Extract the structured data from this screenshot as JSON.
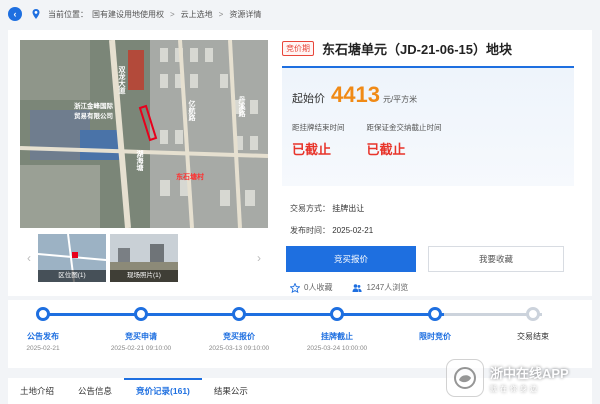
{
  "breadcrumb": {
    "prefix": "当前位置：",
    "items": [
      "国有建设用地使用权",
      "云上选地",
      "资源详情"
    ],
    "separator": ">"
  },
  "listing": {
    "badge": "竞价期",
    "title": "东石塘单元（JD-21-06-15）地块"
  },
  "price": {
    "label": "起始价",
    "value": "4413",
    "unit": "元/平方米"
  },
  "deadlines": [
    {
      "label": "距挂牌结束时间",
      "value": "已截止"
    },
    {
      "label": "距保证金交纳截止时间",
      "value": "已截止"
    }
  ],
  "meta": {
    "method_label": "交易方式：",
    "method_value": "挂牌出让",
    "published_label": "发布时间：",
    "published_value": "2025-02-21"
  },
  "actions": {
    "bid": "竞买报价",
    "favorite": "我要收藏"
  },
  "stats": {
    "favorites": "0人收藏",
    "views": "1247人浏览"
  },
  "map": {
    "road_1": "双龙大道",
    "road_2": "亿航路",
    "road_3": "丹溪路",
    "road_4": "湖海塘",
    "company": "浙江金峰国际\n贸易有限公司",
    "site": "东石塘村"
  },
  "thumbs": [
    "区位图(1)",
    "现场照片(1)"
  ],
  "timeline": [
    {
      "label": "公告发布",
      "date": "2025-02-21"
    },
    {
      "label": "竞买申请",
      "date": "2025-02-21 09:10:00"
    },
    {
      "label": "竞买报价",
      "date": "2025-03-13 09:10:00"
    },
    {
      "label": "挂牌截止",
      "date": "2025-03-24 10:00:00"
    },
    {
      "label": "限时竞价",
      "date": ""
    },
    {
      "label": "交易结束",
      "date": ""
    }
  ],
  "tabs": [
    "土地介绍",
    "公告信息",
    "竞价记录(161)",
    "结果公示"
  ],
  "watermark": {
    "main": "浙中在线APP",
    "sub": "就在你身边"
  },
  "colors": {
    "accent": "#1e6fe0",
    "price": "#f08a16",
    "alert": "#e8342a"
  }
}
